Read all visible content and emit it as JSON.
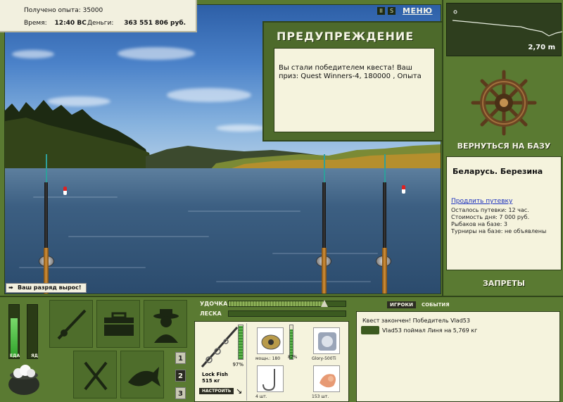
{
  "hud": {
    "xp_label": "Получено опыта:",
    "xp_value": "35000",
    "time_label": "Время:",
    "time_value": "12:40 ВС",
    "money_label": "Деньги:",
    "money_value": "363 551 806 руб."
  },
  "toolbar": {
    "pause_label": "II",
    "sound_label": "S",
    "menu_label": "МЕНЮ"
  },
  "warning": {
    "title": "ПРЕДУПРЕЖДЕНИЕ",
    "message": "Вы стали победителем квеста! Ваш приз: Quest Winners-4, 180000 , Опыта"
  },
  "notification": {
    "rank_message": "Ваш разряд вырос!"
  },
  "depth": {
    "value": "2,70 m"
  },
  "right_panel": {
    "return_base": "ВЕРНУТЬСЯ НА БАЗУ",
    "location": "Беларусь. Березина",
    "extend_trip": "Продлить путевку",
    "trip_left": "Осталось путевки: 12 час.",
    "day_cost": "Стоимость дня: 7 000 руб.",
    "anglers": "Рыбаков на базе: 3",
    "tournaments": "Турниры на базе: не объявлены",
    "bans": "ЗАПРЕТЫ"
  },
  "meters": {
    "food_label": "ЕДА",
    "food_level": 0.72,
    "poison_label": "ЯД",
    "poison_level": 0.0
  },
  "slots": {
    "numbers": [
      "1",
      "2",
      "3"
    ],
    "active": "2"
  },
  "tackle": {
    "rod_label": "УДОЧКА",
    "rod_tension": 0.82,
    "line_label": "ЛЕСКА",
    "line_tension": 0.0,
    "rod_name": "Lock Fish",
    "rod_weight": "515 кг",
    "rod_strength": "97%",
    "rod_strength_level": 0.97,
    "setup_btn": "НАСТРОИТЬ",
    "reel_caption": "мощн.: 180",
    "reel_strength": "87%",
    "reel_strength_level": 0.87,
    "line_caption": "Glory-500Ti",
    "hook_caption": "4 шт.",
    "bait_caption": "153 шт."
  },
  "events": {
    "tab_players": "ИГРОКИ",
    "tab_events": "СОБЫТИЯ",
    "line1": "Квест закончен! Победитель Vlad53",
    "line2": "Vlad53 поймал Линя на 5,769 кг"
  }
}
